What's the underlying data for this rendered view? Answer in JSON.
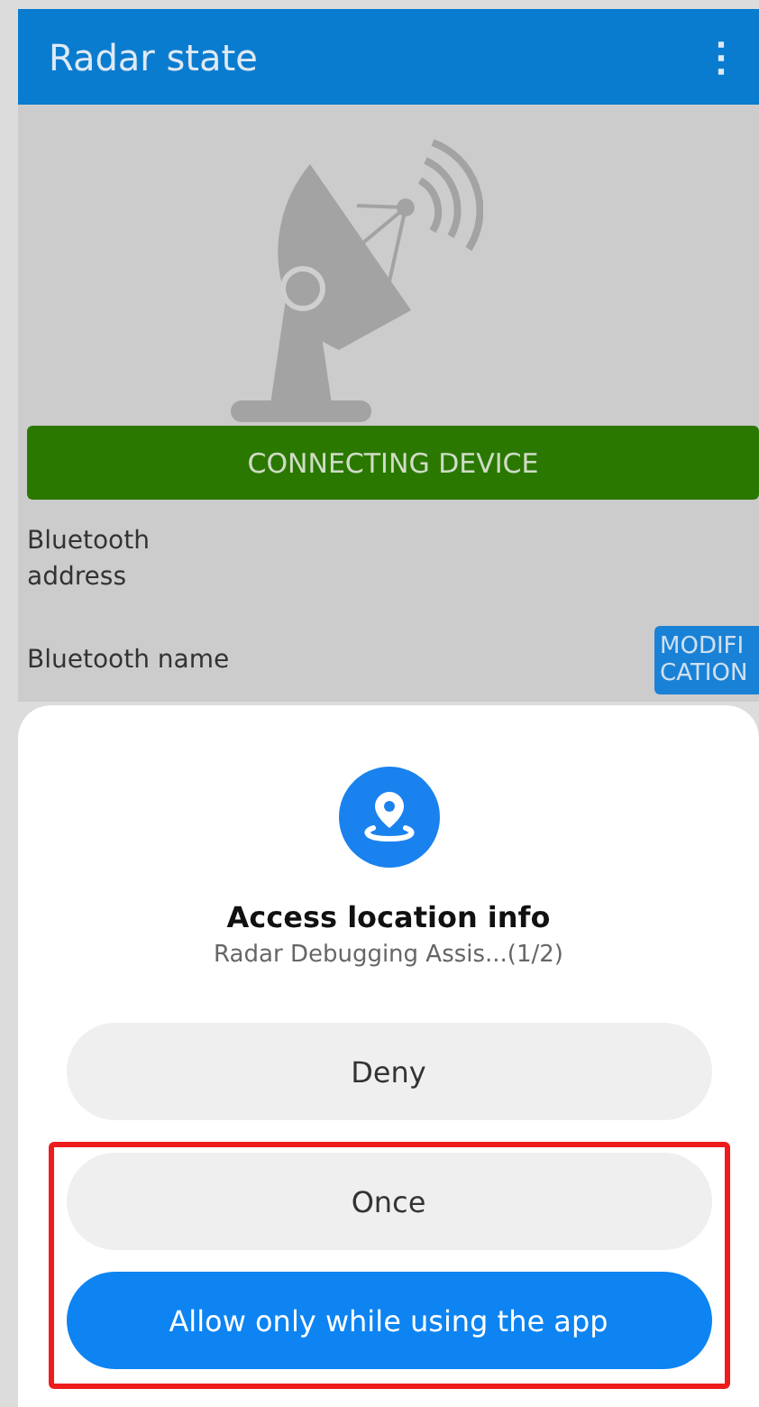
{
  "toolbar": {
    "title": "Radar state",
    "menu_icon": "⋮"
  },
  "connect_button": "CONNECTING DEVICE",
  "fields": [
    {
      "label": "Bluetooth address"
    },
    {
      "label": "Bluetooth name",
      "button": "MODIFICATION"
    }
  ],
  "permission_dialog": {
    "title": "Access location info",
    "subtitle": "Radar Debugging Assis...(1/2)",
    "buttons": [
      {
        "label": "Deny",
        "kind": "secondary"
      }
    ],
    "highlight_frame": {
      "buttons": [
        {
          "label": "Once",
          "kind": "secondary"
        },
        {
          "label": "Allow only while using the app",
          "kind": "primary"
        }
      ]
    }
  }
}
